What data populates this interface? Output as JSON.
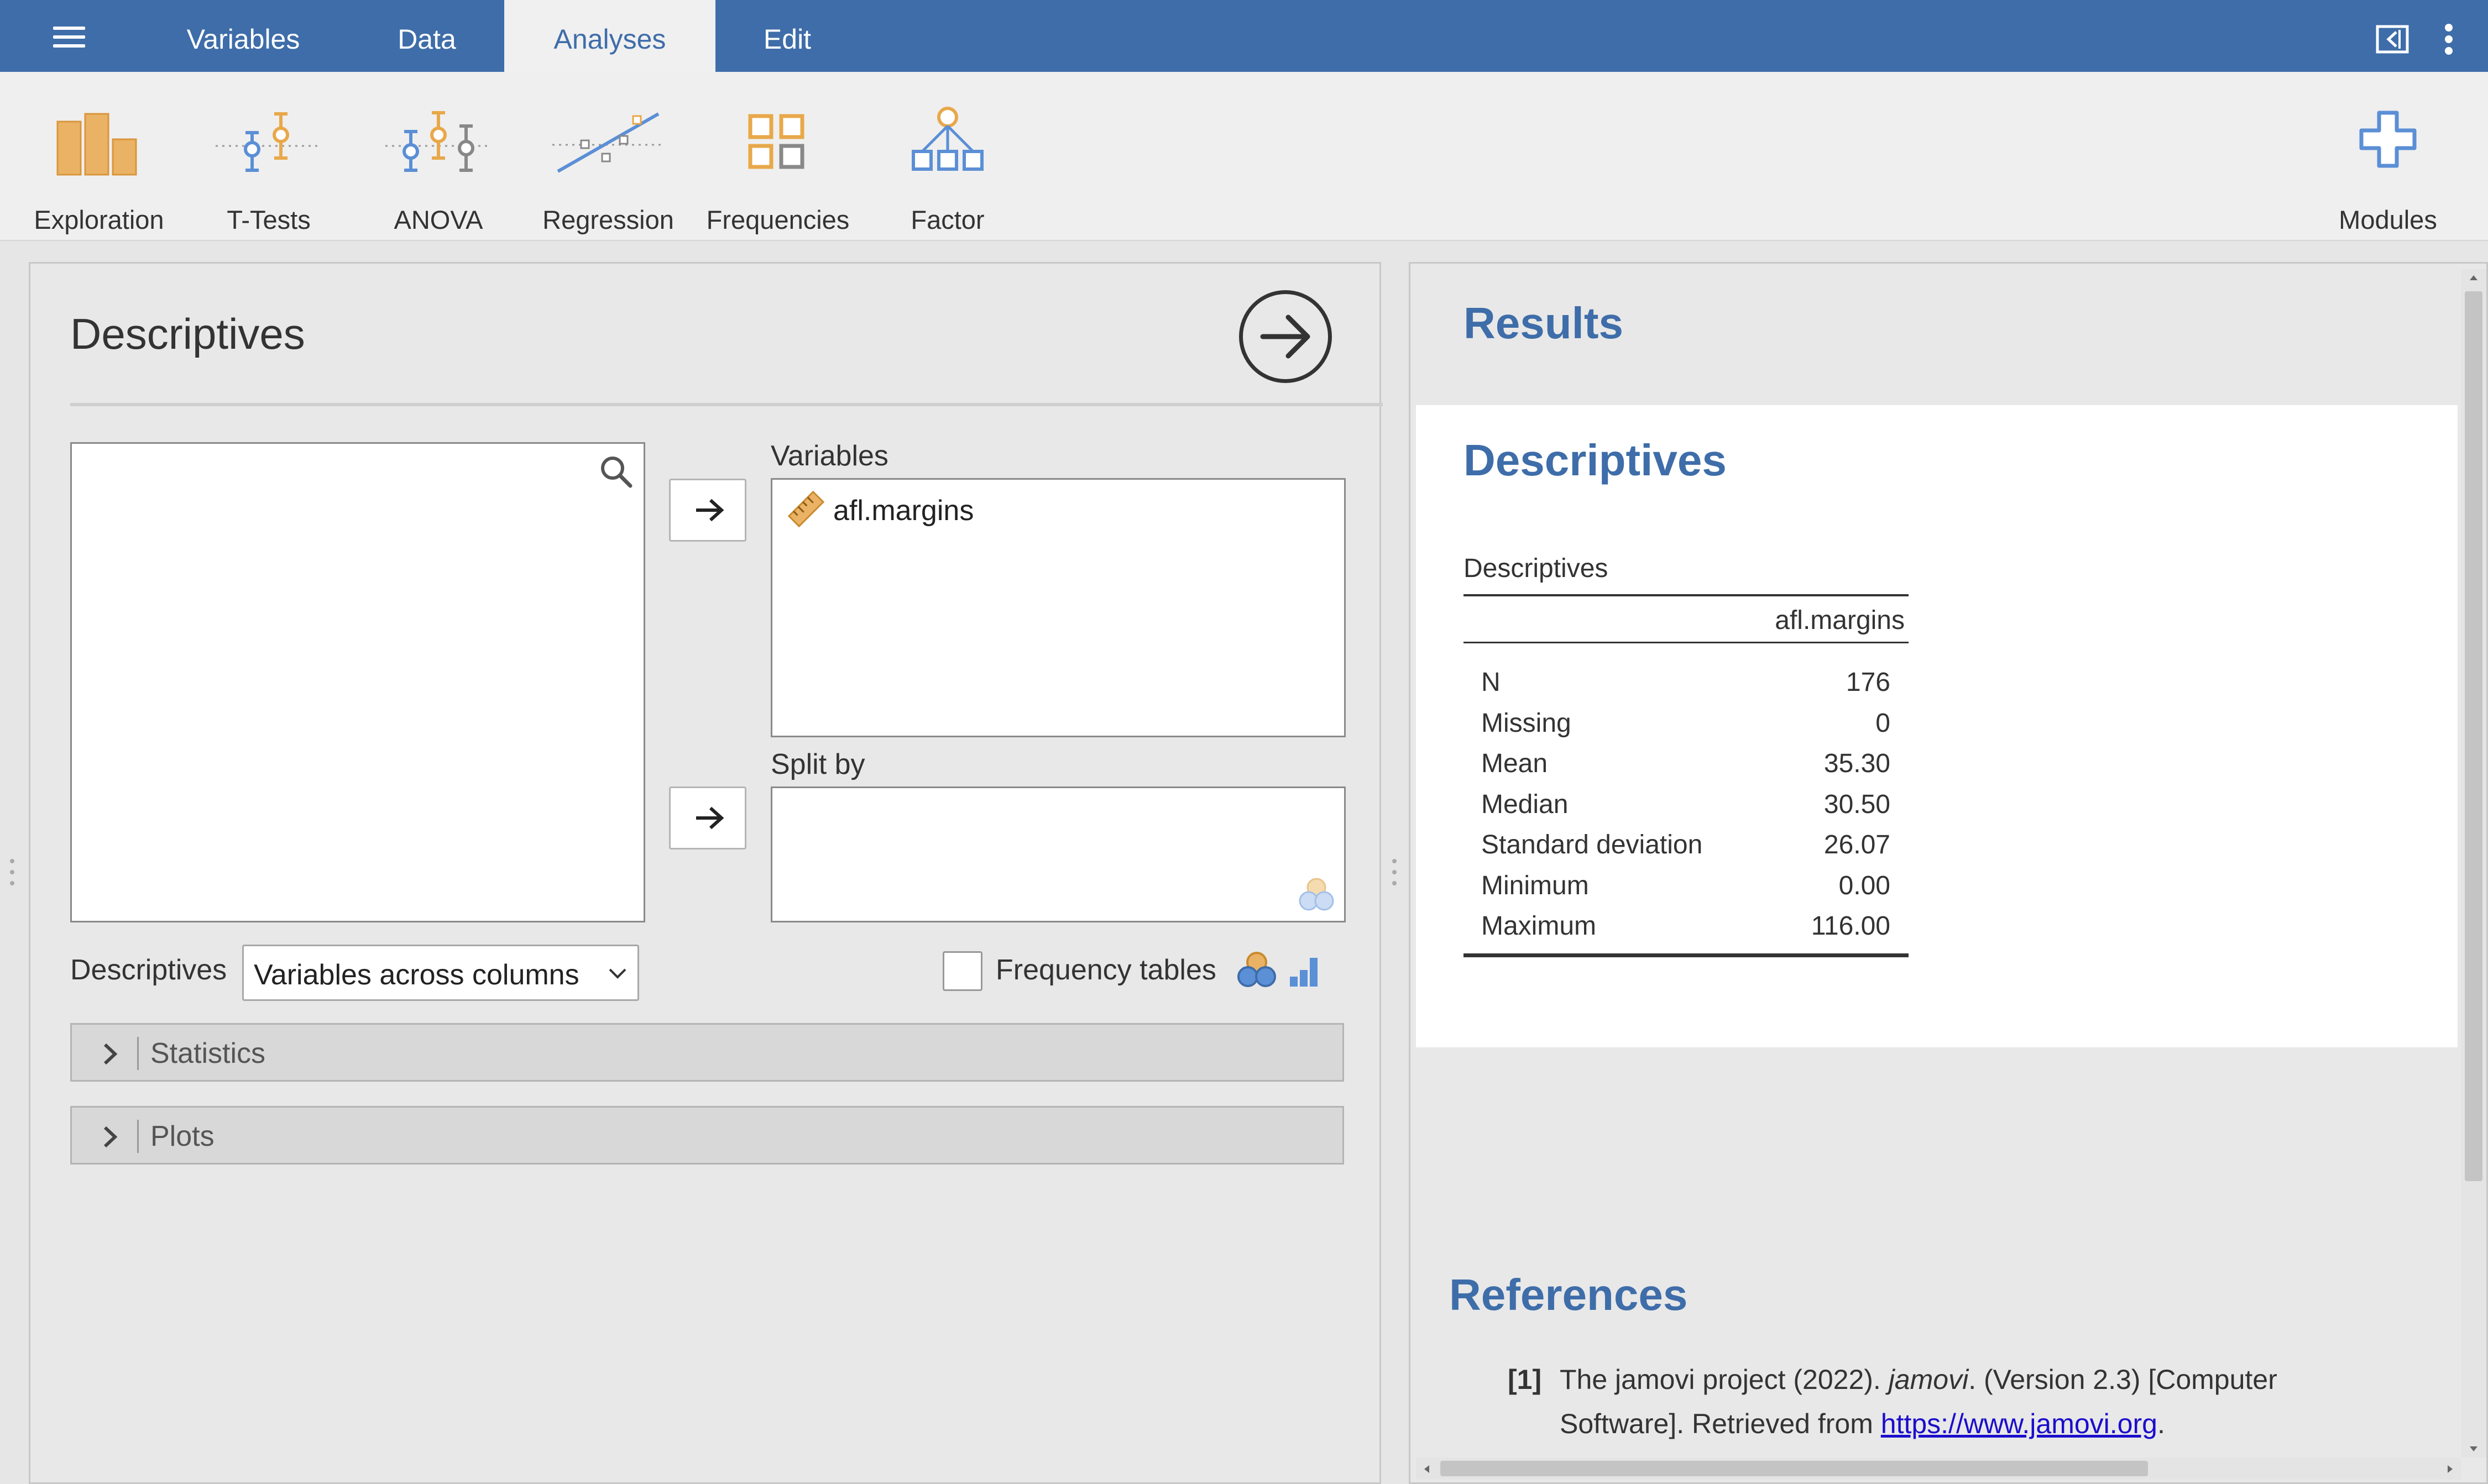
{
  "menubar": {
    "tabs": [
      "Variables",
      "Data",
      "Analyses",
      "Edit"
    ],
    "active_tab": "Analyses"
  },
  "ribbon": {
    "buttons": [
      "Exploration",
      "T-Tests",
      "ANOVA",
      "Regression",
      "Frequencies",
      "Factor"
    ],
    "modules_label": "Modules"
  },
  "options": {
    "title": "Descriptives",
    "variables_label": "Variables",
    "assigned_variable": "afl.margins",
    "split_by_label": "Split by",
    "descriptives_label": "Descriptives",
    "descriptives_select": "Variables across columns",
    "frequency_tables_label": "Frequency tables",
    "frequency_tables_checked": false,
    "sections": [
      "Statistics",
      "Plots"
    ]
  },
  "results": {
    "heading": "Results",
    "analysis_title": "Descriptives",
    "table": {
      "title": "Descriptives",
      "column": "afl.margins",
      "rows": [
        {
          "stat": "N",
          "value": "176"
        },
        {
          "stat": "Missing",
          "value": "0"
        },
        {
          "stat": "Mean",
          "value": "35.30"
        },
        {
          "stat": "Median",
          "value": "30.50"
        },
        {
          "stat": "Standard deviation",
          "value": "26.07"
        },
        {
          "stat": "Minimum",
          "value": "0.00"
        },
        {
          "stat": "Maximum",
          "value": "116.00"
        }
      ]
    },
    "references": {
      "heading": "References",
      "num": "[1]",
      "text_before": "The jamovi project (2022). ",
      "text_italic": "jamovi",
      "text_after": ". (Version 2.3) [Computer",
      "text_line2": "Software]. Retrieved from ",
      "link": "https://www.jamovi.org",
      "text_end": "."
    }
  },
  "colors": {
    "brand": "#3e6da9",
    "accent_orange": "#e8a84a",
    "accent_blue": "#5b8fd6"
  }
}
